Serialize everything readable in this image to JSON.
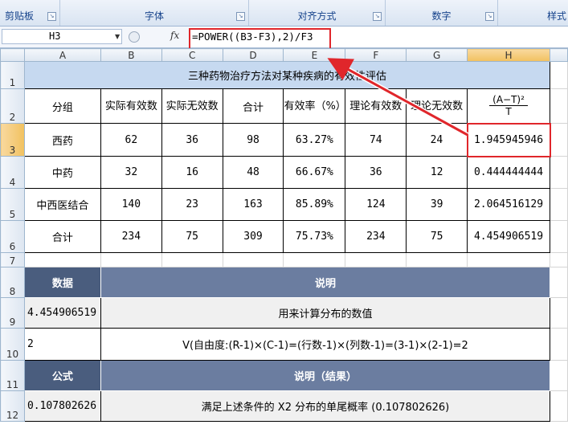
{
  "ribbon": {
    "groups": [
      "剪贴板",
      "字体",
      "对齐方式",
      "数字",
      "样式"
    ]
  },
  "formula_bar": {
    "name_box": "H3",
    "fx": "fx",
    "formula": "=POWER((B3-F3),2)/F3"
  },
  "columns": [
    "A",
    "B",
    "C",
    "D",
    "E",
    "F",
    "G",
    "H"
  ],
  "rows": [
    "1",
    "2",
    "3",
    "4",
    "5",
    "6",
    "7",
    "8",
    "9",
    "10",
    "11",
    "12"
  ],
  "sheet": {
    "title": "三种药物治疗方法对某种疾病的有效性评估",
    "headers": {
      "group": "分组",
      "actual_eff": "实际有效数",
      "actual_ineff": "实际无效数",
      "total": "合计",
      "rate": "有效率（%）",
      "theory_eff": "理论有效数",
      "theory_ineff": "理论无效数",
      "h_top": "(A−T)²",
      "h_bottom": "T"
    },
    "data_rows": [
      {
        "group": "西药",
        "b": "62",
        "c": "36",
        "d": "98",
        "e": "63.27%",
        "f": "74",
        "g": "24",
        "h": "1.945945946"
      },
      {
        "group": "中药",
        "b": "32",
        "c": "16",
        "d": "48",
        "e": "66.67%",
        "f": "36",
        "g": "12",
        "h": "0.444444444"
      },
      {
        "group": "中西医结合",
        "b": "140",
        "c": "23",
        "d": "163",
        "e": "85.89%",
        "f": "124",
        "g": "39",
        "h": "2.064516129"
      },
      {
        "group": "合计",
        "b": "234",
        "c": "75",
        "d": "309",
        "e": "75.73%",
        "f": "234",
        "g": "75",
        "h": "4.454906519"
      }
    ],
    "section1": {
      "col1": "数据",
      "col2": "说明",
      "r9_a": "4.454906519",
      "r9_desc": "用来计算分布的数值",
      "r10_a": "2",
      "r10_desc": "V(自由度:(R-1)×(C-1)=(行数-1)×(列数-1)=(3-1)×(2-1)=2"
    },
    "section2": {
      "col1": "公式",
      "col2": "说明（结果）",
      "r12_a": "0.107802626",
      "r12_desc": "满足上述条件的 X2 分布的单尾概率 (0.107802626)"
    }
  },
  "colors": {
    "highlight": "#e0262b",
    "title_bg": "#c6d9f0",
    "dark_header": "#4a5d7e"
  }
}
